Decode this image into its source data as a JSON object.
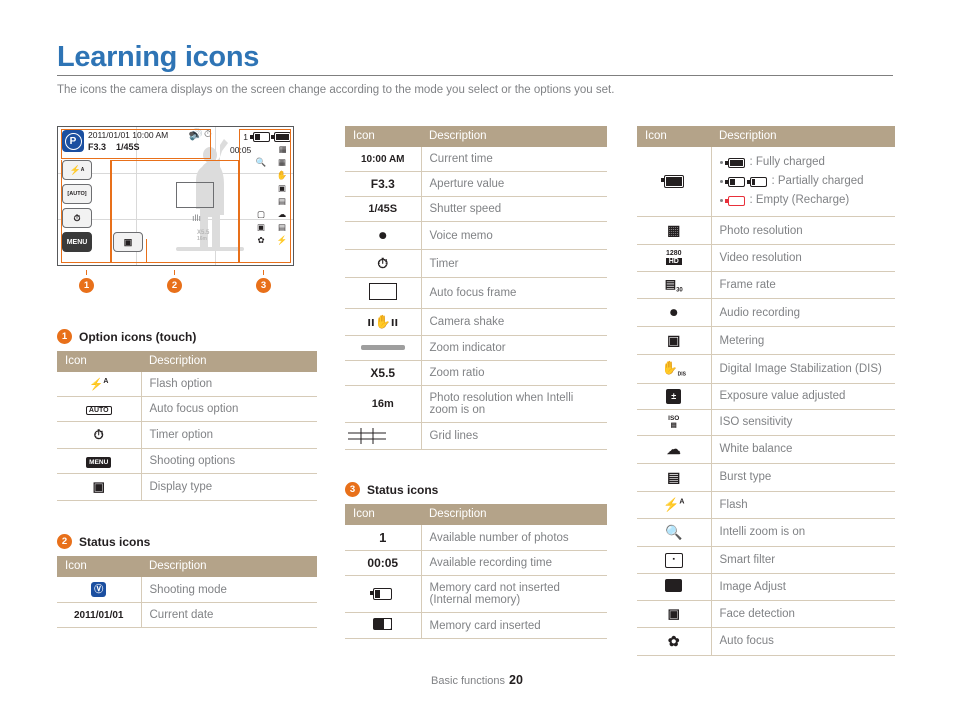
{
  "page": {
    "title": "Learning icons",
    "subtitle": "The icons the camera displays on the screen change according to the mode you select or the options you set.",
    "footer_label": "Basic functions",
    "footer_page": "20",
    "accent_color": "#e8701a",
    "title_color": "#2e74b5",
    "table_header_color": "#b4a389"
  },
  "screen": {
    "date": "2011/01/01",
    "time": "10:00 AM",
    "aperture": "F3.3",
    "shutter": "1/45S",
    "mode_badge": "P",
    "photos_available": "1",
    "recording_time": "00:05",
    "zoom_ratio": "X5.5",
    "zoom_sub": "16m",
    "markers": [
      "1",
      "2",
      "3"
    ]
  },
  "sections": {
    "option_icons": {
      "number": "1",
      "title": "Option icons (touch)",
      "columns": [
        "Icon",
        "Description"
      ],
      "rows": [
        {
          "icon": "flash-auto-icon",
          "icon_text": "",
          "desc": "Flash option"
        },
        {
          "icon": "auto-focus-icon",
          "icon_text": "",
          "desc": "Auto focus option"
        },
        {
          "icon": "timer-icon",
          "icon_text": "",
          "desc": "Timer option"
        },
        {
          "icon": "menu-icon",
          "icon_text": "MENU",
          "desc": "Shooting options"
        },
        {
          "icon": "display-type-icon",
          "icon_text": "",
          "desc": "Display type"
        }
      ]
    },
    "status_icons_2": {
      "number": "2",
      "title": "Status icons",
      "columns": [
        "Icon",
        "Description"
      ],
      "rows": [
        {
          "icon": "shooting-mode-icon",
          "icon_text": "",
          "desc": "Shooting mode"
        },
        {
          "icon": "date-text",
          "icon_text": "2011/01/01",
          "desc": "Current date"
        }
      ]
    },
    "middle_table": {
      "columns": [
        "Icon",
        "Description"
      ],
      "rows": [
        {
          "icon": "current-time-text",
          "icon_text": "10:00 AM",
          "desc": "Current time"
        },
        {
          "icon": "aperture-text",
          "icon_text": "F3.3",
          "desc": "Aperture value"
        },
        {
          "icon": "shutter-speed-text",
          "icon_text": "1/45S",
          "desc": "Shutter speed"
        },
        {
          "icon": "voice-memo-icon",
          "icon_text": "",
          "desc": "Voice memo"
        },
        {
          "icon": "timer-icon",
          "icon_text": "",
          "desc": "Timer"
        },
        {
          "icon": "auto-focus-frame-icon",
          "icon_text": "",
          "desc": "Auto focus frame"
        },
        {
          "icon": "camera-shake-icon",
          "icon_text": "",
          "desc": "Camera shake"
        },
        {
          "icon": "zoom-indicator-icon",
          "icon_text": "",
          "desc": "Zoom indicator"
        },
        {
          "icon": "zoom-ratio-text",
          "icon_text": "X5.5",
          "desc": "Zoom ratio"
        },
        {
          "icon": "intelli-resolution-icon",
          "icon_text": "16m",
          "desc": "Photo resolution when Intelli zoom is on"
        },
        {
          "icon": "grid-lines-icon",
          "icon_text": "",
          "desc": "Grid lines"
        }
      ]
    },
    "status_icons_3": {
      "number": "3",
      "title": "Status icons",
      "columns": [
        "Icon",
        "Description"
      ],
      "rows": [
        {
          "icon": "photos-count-text",
          "icon_text": "1",
          "desc": "Available number of photos"
        },
        {
          "icon": "recording-time-text",
          "icon_text": "00:05",
          "desc": "Available recording time"
        },
        {
          "icon": "internal-memory-icon",
          "icon_text": "",
          "desc": "Memory card not inserted (Internal memory)"
        },
        {
          "icon": "memory-card-icon",
          "icon_text": "",
          "desc": "Memory card inserted"
        }
      ]
    },
    "right_table": {
      "columns": [
        "Icon",
        "Description"
      ],
      "battery_row": {
        "icon": "battery-icon",
        "bullets": [
          {
            "glyph": "battery-full-icon",
            "text": ": Fully charged"
          },
          {
            "glyph": "battery-partial-icon",
            "text": ": Partially charged"
          },
          {
            "glyph": "battery-empty-icon",
            "text": ": Empty (Recharge)"
          }
        ]
      },
      "rows": [
        {
          "icon": "photo-resolution-icon",
          "icon_text": "",
          "desc": "Photo resolution"
        },
        {
          "icon": "video-resolution-icon",
          "icon_text": "1280",
          "desc": "Video resolution"
        },
        {
          "icon": "frame-rate-icon",
          "icon_text": "30",
          "desc": "Frame rate"
        },
        {
          "icon": "audio-recording-icon",
          "icon_text": "",
          "desc": "Audio recording"
        },
        {
          "icon": "metering-icon",
          "icon_text": "",
          "desc": "Metering"
        },
        {
          "icon": "dis-icon",
          "icon_text": "DIS",
          "desc": "Digital Image Stabilization (DIS)"
        },
        {
          "icon": "exposure-value-icon",
          "icon_text": "",
          "desc": "Exposure value adjusted"
        },
        {
          "icon": "iso-icon",
          "icon_text": "ISO",
          "desc": "ISO sensitivity"
        },
        {
          "icon": "white-balance-icon",
          "icon_text": "",
          "desc": "White balance"
        },
        {
          "icon": "burst-type-icon",
          "icon_text": "",
          "desc": "Burst type"
        },
        {
          "icon": "flash-icon",
          "icon_text": "",
          "desc": "Flash"
        },
        {
          "icon": "intelli-zoom-icon",
          "icon_text": "",
          "desc": "Intelli zoom is on"
        },
        {
          "icon": "smart-filter-icon",
          "icon_text": "",
          "desc": "Smart filter"
        },
        {
          "icon": "image-adjust-icon",
          "icon_text": "",
          "desc": "Image Adjust"
        },
        {
          "icon": "face-detection-icon",
          "icon_text": "",
          "desc": "Face detection"
        },
        {
          "icon": "auto-focus-macro-icon",
          "icon_text": "",
          "desc": "Auto focus"
        }
      ]
    }
  }
}
